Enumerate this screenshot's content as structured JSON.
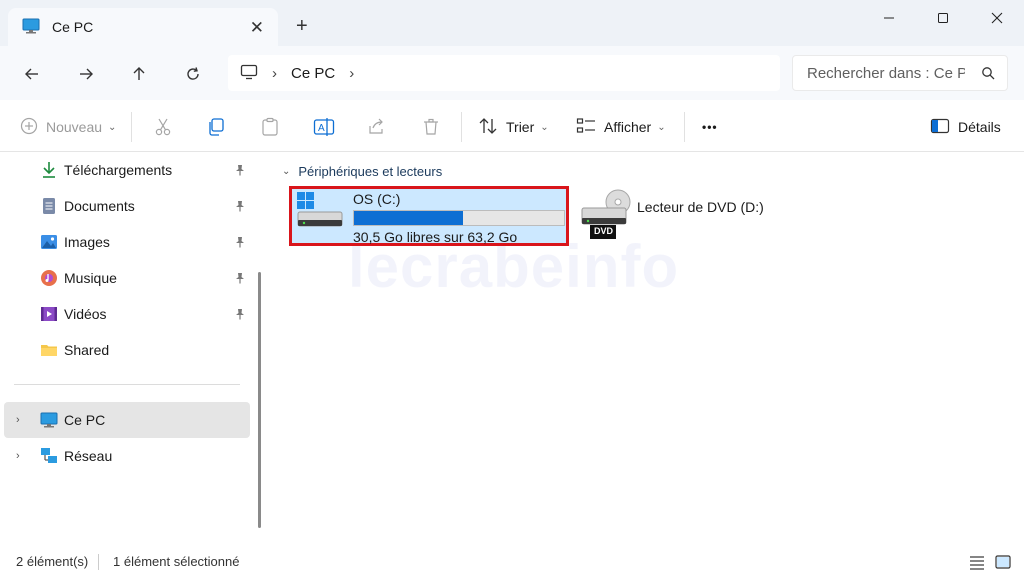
{
  "window": {
    "tab_title": "Ce PC",
    "close_tab_glyph": "✕",
    "new_tab_glyph": "+",
    "accent": "#0d6ed3"
  },
  "navigation": {
    "breadcrumb": [
      "Ce PC"
    ],
    "search_placeholder": "Rechercher dans : Ce PC"
  },
  "toolbar": {
    "new_label": "Nouveau",
    "sort_label": "Trier",
    "view_label": "Afficher",
    "more_label": "•••",
    "details_label": "Détails"
  },
  "sidebar": {
    "quick_access": [
      {
        "label": "Téléchargements",
        "icon": "download-icon",
        "pinned": true
      },
      {
        "label": "Documents",
        "icon": "document-icon",
        "pinned": true
      },
      {
        "label": "Images",
        "icon": "picture-icon",
        "pinned": true
      },
      {
        "label": "Musique",
        "icon": "music-icon",
        "pinned": true
      },
      {
        "label": "Vidéos",
        "icon": "video-icon",
        "pinned": true
      },
      {
        "label": "Shared",
        "icon": "folder-icon",
        "pinned": false
      }
    ],
    "this_pc": {
      "label": "Ce PC",
      "icon": "monitor-icon",
      "selected": true
    },
    "network": {
      "label": "Réseau",
      "icon": "network-icon"
    }
  },
  "main": {
    "group_header": "Périphériques et lecteurs",
    "drives": [
      {
        "name": "OS (C:)",
        "free_text": "30,5 Go libres sur 63,2 Go",
        "used_fraction": 0.517,
        "selected": true,
        "icon": "windows-drive-icon"
      },
      {
        "name": "Lecteur de DVD (D:)",
        "icon": "dvd-drive-icon",
        "badge": "DVD"
      }
    ],
    "watermark": "lecrabeinfo"
  },
  "status": {
    "item_count": "2 élément(s)",
    "selection": "1 élément sélectionné"
  }
}
